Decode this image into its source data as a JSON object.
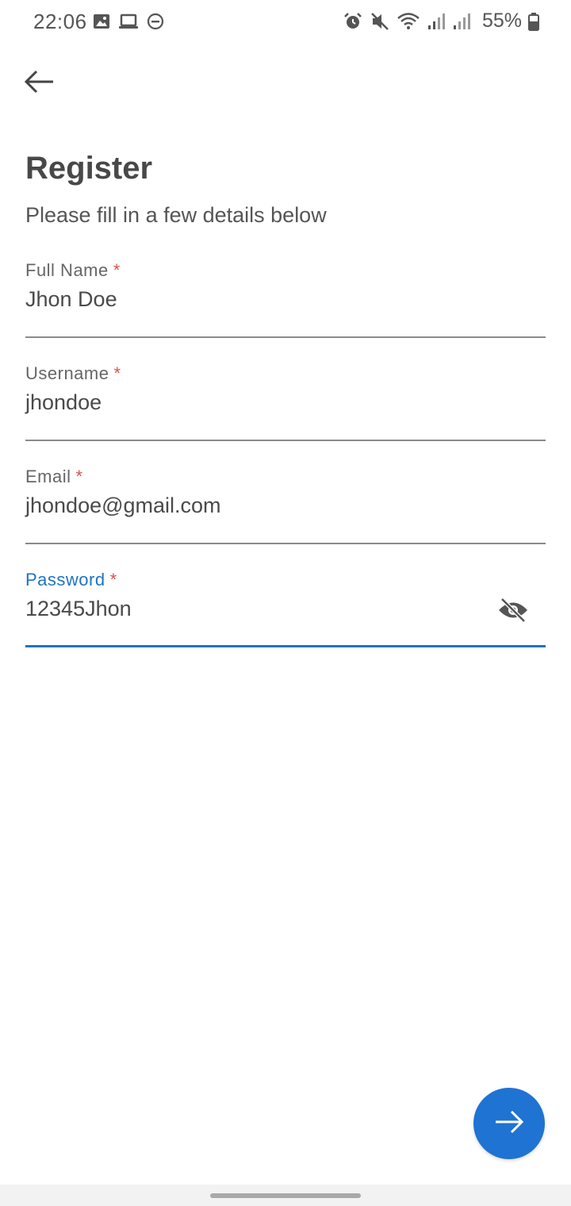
{
  "status_bar": {
    "time": "22:06",
    "battery": "55%",
    "left_icons": [
      "image-icon",
      "laptop-icon",
      "do-not-disturb-icon"
    ],
    "right_icons": [
      "alarm-icon",
      "mute-icon",
      "wifi-icon",
      "signal-icon",
      "signal-icon",
      "battery-icon"
    ]
  },
  "header": {
    "back_icon": "arrow-left-icon",
    "title": "Register",
    "subtitle": "Please fill in a few details below"
  },
  "form": {
    "full_name": {
      "label": "Full Name",
      "required_mark": "*",
      "value": "Jhon Doe"
    },
    "username": {
      "label": "Username",
      "required_mark": "*",
      "value": "jhondoe"
    },
    "email": {
      "label": "Email",
      "required_mark": "*",
      "value": "jhondoe@gmail.com"
    },
    "password": {
      "label": "Password",
      "required_mark": "*",
      "value": "12345Jhon",
      "toggle_icon": "eye-off-icon"
    }
  },
  "fab": {
    "icon": "arrow-right-icon"
  },
  "colors": {
    "accent": "#1f73d2",
    "required": "#d9534f",
    "text": "#4a4a4a"
  }
}
